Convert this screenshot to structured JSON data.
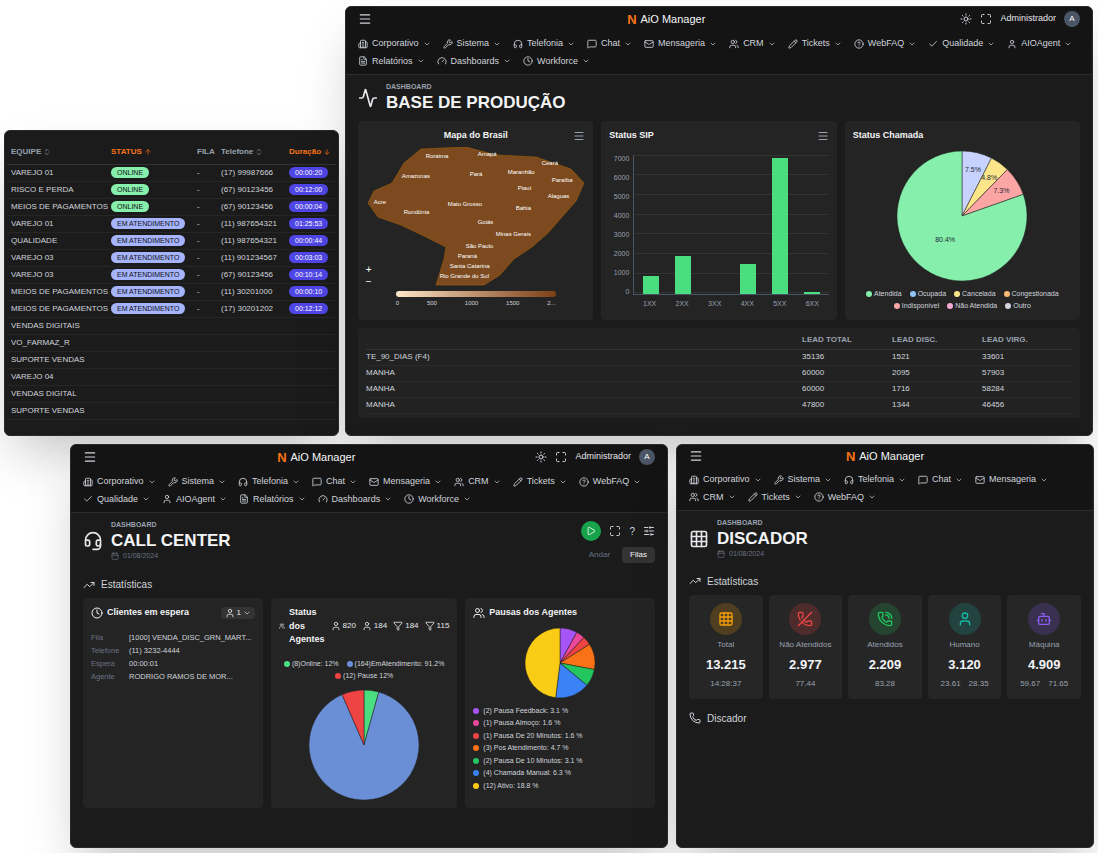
{
  "agent_table": {
    "columns": [
      {
        "label": "EQUIPE",
        "sort": "none"
      },
      {
        "label": "STATUS",
        "sort": "asc"
      },
      {
        "label": "FILA",
        "sort": "none"
      },
      {
        "label": "Telefone",
        "sort": "none"
      },
      {
        "label": "Duração",
        "sort": "desc"
      }
    ],
    "rows": [
      {
        "team": "VAREJO 01",
        "status": "ONLINE",
        "status_color": "#86efac",
        "queue": "-",
        "phone": "(17) 99987666",
        "duration": "00:00:20"
      },
      {
        "team": "RISCO E PERDA",
        "status": "ONLINE",
        "status_color": "#86efac",
        "queue": "-",
        "phone": "(67) 90123456",
        "duration": "00:12:00"
      },
      {
        "team": "MEIOS DE PAGAMENTOS",
        "status": "ONLINE",
        "status_color": "#86efac",
        "queue": "-",
        "phone": "(67) 90123456",
        "duration": "00:00:04"
      },
      {
        "team": "VAREJO 01",
        "status": "EM ATENDIMENTO",
        "status_color": "#a5b4fc",
        "queue": "-",
        "phone": "(11) 987654321",
        "duration": "01:25:53"
      },
      {
        "team": "QUALIDADE",
        "status": "EM ATENDIMENTO",
        "status_color": "#a5b4fc",
        "queue": "-",
        "phone": "(11) 987654321",
        "duration": "00:00:44"
      },
      {
        "team": "VAREJO 03",
        "status": "EM ATENDIMENTO",
        "status_color": "#a5b4fc",
        "queue": "-",
        "phone": "(11) 901234567",
        "duration": "00:03:03"
      },
      {
        "team": "VAREJO 03",
        "status": "EM ATENDIMENTO",
        "status_color": "#a5b4fc",
        "queue": "-",
        "phone": "(67) 90123456",
        "duration": "00:10:14"
      },
      {
        "team": "MEIOS DE PAGAMENTOS",
        "status": "EM ATENDIMENTO",
        "status_color": "#a5b4fc",
        "queue": "-",
        "phone": "(11) 30201000",
        "duration": "00:00:10"
      },
      {
        "team": "MEIOS DE PAGAMENTOS",
        "status": "EM ATENDIMENTO",
        "status_color": "#a5b4fc",
        "queue": "-",
        "phone": "(17) 30201202",
        "duration": "00:12:12"
      },
      {
        "team": "VENDAS DIGITAIS"
      },
      {
        "team": "VO_FARMAZ_R"
      },
      {
        "team": "SUPORTE VENDAS"
      },
      {
        "team": "VAREJO 04"
      },
      {
        "team": "VENDAS DIGITAL"
      },
      {
        "team": "SUPORTE VENDAS"
      }
    ]
  },
  "production_dashboard": {
    "logo": {
      "mark": "N",
      "name": "AiO Manager"
    },
    "user": {
      "name": "Administrador",
      "initial": "A"
    },
    "nav": [
      "Corporativo",
      "Sistema",
      "Telefonia",
      "Chat",
      "Mensageria",
      "CRM",
      "Tickets",
      "WebFAQ",
      "Qualidade",
      "AIOAgent",
      "Relatórios",
      "Dashboards",
      "Workforce"
    ],
    "kicker": "DASHBOARD",
    "title": "BASE DE PRODUÇÃO",
    "map": {
      "title": "Mapa do Brasil",
      "zoom_in": "+",
      "zoom_out": "−",
      "states": [
        "Roraima",
        "Amapá",
        "Amazonas",
        "Pará",
        "Maranhão",
        "Ceará",
        "Paraíba",
        "Piauí",
        "Alagoas",
        "Acre",
        "Rondônia",
        "Mato Grosso",
        "Bahia",
        "Goiás",
        "Minas Gerais",
        "São Paulo",
        "Paraná",
        "Santa Catarina",
        "Rio Grande do Sul"
      ],
      "scale": [
        "0",
        "500",
        "1000",
        "1500",
        "2..."
      ]
    },
    "sip": {
      "title": "Status SIP",
      "y_ticks": [
        "7000",
        "6000",
        "5000",
        "4000",
        "3000",
        "2000",
        "1000",
        "0"
      ],
      "categories": [
        "1XX",
        "2XX",
        "3XX",
        "4XX",
        "5XX",
        "6XX"
      ],
      "values": [
        900,
        1900,
        0,
        1500,
        6800,
        100
      ]
    },
    "call_status": {
      "title": "Status Chamada",
      "slices": [
        {
          "label": "7.5%",
          "value": 7.5,
          "color": "#c7d2fe"
        },
        {
          "label": "4.8%",
          "value": 4.8,
          "color": "#fde68a"
        },
        {
          "label": "7.3%",
          "value": 7.3,
          "color": "#fca5a5"
        },
        {
          "label": "80.4%",
          "value": 80.4,
          "color": "#86efac"
        }
      ],
      "legend": [
        {
          "label": "Atendida",
          "color": "#86efac"
        },
        {
          "label": "Ocupada",
          "color": "#93c5fd"
        },
        {
          "label": "Cancelada",
          "color": "#fde68a"
        },
        {
          "label": "Congestionada",
          "color": "#fdba74"
        },
        {
          "label": "Indisponível",
          "color": "#fca5a5"
        },
        {
          "label": "Não Atendida",
          "color": "#f9a8d4"
        },
        {
          "label": "Outro",
          "color": "#d1d5db"
        }
      ]
    },
    "leads": {
      "columns": [
        "LEAD TOTAL",
        "LEAD DISC.",
        "LEAD VIRG."
      ],
      "rows": [
        {
          "name": "TE_90_DIAS (F4)",
          "values": [
            "35136",
            "1521",
            "33601"
          ]
        },
        {
          "name": "MANHA",
          "values": [
            "60000",
            "2095",
            "57903"
          ]
        },
        {
          "name": "MANHA",
          "values": [
            "60000",
            "1716",
            "58284"
          ]
        },
        {
          "name": "MANHA",
          "values": [
            "47800",
            "1344",
            "46456"
          ]
        }
      ]
    }
  },
  "call_center_dashboard": {
    "logo": {
      "mark": "N",
      "name": "AiO Manager"
    },
    "user": {
      "name": "Administrador",
      "initial": "A"
    },
    "nav": [
      "Corporativo",
      "Sistema",
      "Telefonia",
      "Chat",
      "Mensageria",
      "CRM",
      "Tickets",
      "WebFAQ",
      "Qualidade",
      "AIOAgent",
      "Relatórios",
      "Dashboards",
      "Workforce"
    ],
    "kicker": "DASHBOARD",
    "title": "CALL CENTER",
    "date": "01/08/2024",
    "help": "?",
    "tabs": [
      {
        "label": "Andar",
        "selected": false
      },
      {
        "label": "Filas",
        "selected": true
      }
    ],
    "section": "Estatísticas",
    "waiting": {
      "title": "Clientes em espera",
      "count": "1",
      "fields": [
        {
          "label": "Fila",
          "value": "[1000] VENDA_DISC_GRN_MART..."
        },
        {
          "label": "Telefone",
          "value": "(11) 3232-4444"
        },
        {
          "label": "Espera",
          "value": "00:00:01"
        },
        {
          "label": "Agente",
          "value": "RODRIGO RAMOS DE MOR..."
        }
      ]
    },
    "agents": {
      "title": "Status dos Agentes",
      "counts": [
        "820",
        "184",
        "184",
        "115"
      ],
      "slices": [
        {
          "label": "(8)Online: 12%",
          "value": 8,
          "color": "#4ade80"
        },
        {
          "label": "(164)EmAtendimento: 91.2%",
          "value": 164,
          "color": "#6b8fd6"
        },
        {
          "label": "(12) Pause 12%",
          "value": 12,
          "color": "#ef4444"
        }
      ]
    },
    "pauses": {
      "title": "Pausas dos Agentes",
      "slices": [
        {
          "label": "(2) Pausa Feedback: 3.1 %",
          "value": 2,
          "color": "#a855f7"
        },
        {
          "label": "(1) Pausa Almoço: 1.6 %",
          "value": 1,
          "color": "#ec4899"
        },
        {
          "label": "(1) Pausa De 20 Minutos: 1.6 %",
          "value": 1,
          "color": "#ef4444"
        },
        {
          "label": "(3) Pos Atendimento: 4.7 %",
          "value": 3,
          "color": "#f97316"
        },
        {
          "label": "(2) Pausa De 10 Minutos: 3.1 %",
          "value": 2,
          "color": "#22c55e"
        },
        {
          "label": "(4) Chamada Manual: 6.3 %",
          "value": 4,
          "color": "#3b82f6"
        },
        {
          "label": "(12) Ativo: 18.8 %",
          "value": 12,
          "color": "#facc15"
        }
      ]
    }
  },
  "dialer_dashboard": {
    "logo": {
      "mark": "N",
      "name": "AiO Manager"
    },
    "nav": [
      "Corporativo",
      "Sistema",
      "Telefonia",
      "Chat",
      "Mensageria",
      "CRM",
      "Tickets",
      "WebFAQ"
    ],
    "kicker": "DASHBOARD",
    "title": "DISCADOR",
    "date": "01/08/2024",
    "section": "Estatísticas",
    "stats": [
      {
        "label": "Total",
        "value": "13.215",
        "sub": [
          "14:28:37"
        ],
        "color": "#f59e0b"
      },
      {
        "label": "Não Atendidos",
        "value": "2.977",
        "sub": [
          "77.44"
        ],
        "color": "#ef4444"
      },
      {
        "label": "Atendidos",
        "value": "2.209",
        "sub": [
          "83.28"
        ],
        "color": "#22c55e"
      },
      {
        "label": "Humano",
        "value": "3.120",
        "sub": [
          "23.61",
          "28.35"
        ],
        "color": "#14b8a6"
      },
      {
        "label": "Máquina",
        "value": "4.909",
        "sub": [
          "59.67",
          "71.65"
        ],
        "color": "#8b5cf6"
      }
    ],
    "footer_section": "Discador"
  }
}
